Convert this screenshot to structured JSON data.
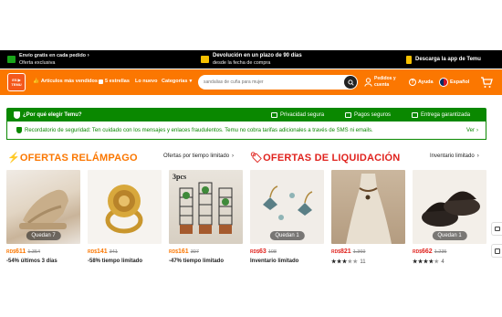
{
  "topbar": {
    "shipping_title": "Envío gratis en cada pedido",
    "shipping_sub": "Oferta exclusiva",
    "return_title": "Devolución en un plazo de 90 días",
    "return_sub": "desde la fecha de compra",
    "app_label": "Descarga la app de Temu"
  },
  "header": {
    "logo_text": "ES ▶ TEMU",
    "nav": [
      {
        "label": "Artículos más vendidos"
      },
      {
        "label": "5 estrellas"
      },
      {
        "label": "Lo nuevo"
      },
      {
        "label": "Categorías"
      }
    ],
    "search_placeholder": "sandalias de cuña para mujer",
    "orders_line1": "Pedidos y",
    "orders_line2": "cuenta",
    "help_label": "Ayuda",
    "language_label": "Español"
  },
  "trust": {
    "why_label": "¿Por qué elegir Temu?",
    "perks": [
      "Privacidad segura",
      "Pagos seguros",
      "Entrega garantizada"
    ],
    "notice": "Recordatorio de seguridad: Ten cuidado con los mensajes y enlaces fraudulentos. Temu no cobra tarifas adicionales a través de SMS ni emails.",
    "more_label": "Ver"
  },
  "flash": {
    "title": "OFERTAS RELÁMPAGO",
    "link": "Ofertas por tiempo limitado",
    "products": [
      {
        "badge": "Quedan 7",
        "currency": "RD$",
        "price": "611",
        "old": "1.354",
        "sub": "-54% últimos 3 días"
      },
      {
        "badge": "",
        "currency": "RD$",
        "price": "141",
        "old": "341",
        "sub": "-58% tiempo limitado"
      },
      {
        "badge": "",
        "currency": "RD$",
        "price": "161",
        "old": "307",
        "sub": "-47% tiempo limitado",
        "img_text": "3pcs"
      }
    ]
  },
  "clearance": {
    "title": "OFERTAS DE LIQUIDACIÓN",
    "link": "Inventario limitado",
    "products": [
      {
        "badge": "Quedan 1",
        "currency": "RD$",
        "price": "63",
        "old": "108",
        "sub": "Inventario limitado"
      },
      {
        "badge": "",
        "currency": "RD$",
        "price": "821",
        "old": "1.369",
        "rating": 3.5,
        "reviews": "11"
      },
      {
        "badge": "Quedan 1",
        "currency": "RD$",
        "price": "662",
        "old": "1.235",
        "rating": 4.5,
        "reviews": "4"
      }
    ]
  },
  "colors": {
    "brand_orange": "#fb7701",
    "trust_green": "#0a8800",
    "clearance_red": "#e0231e"
  }
}
